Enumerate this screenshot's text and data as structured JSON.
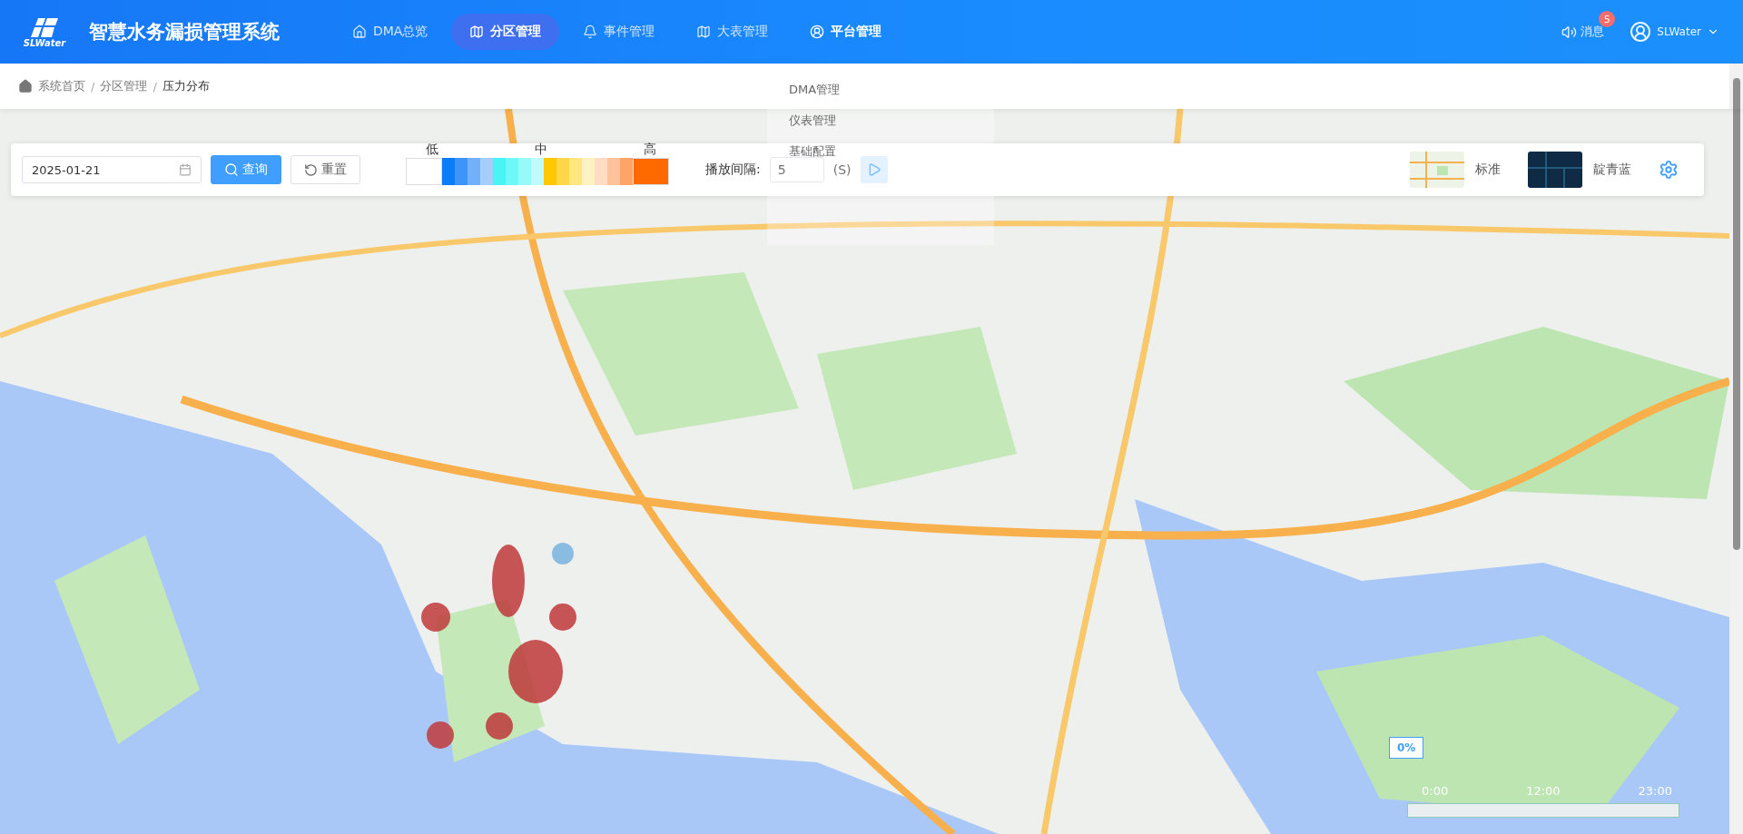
{
  "header": {
    "logo_text": "SLWater",
    "title": "智慧水务漏损管理系统",
    "nav": [
      {
        "label": "DMA总览",
        "selected": false,
        "expanded": false
      },
      {
        "label": "分区管理",
        "selected": true,
        "expanded": false
      },
      {
        "label": "事件管理",
        "selected": false,
        "expanded": false
      },
      {
        "label": "大表管理",
        "selected": false,
        "expanded": false
      },
      {
        "label": "平台管理",
        "selected": false,
        "expanded": true
      }
    ],
    "messages": {
      "label": "消息",
      "badge": "5"
    },
    "user": "SLWater"
  },
  "breadcrumb": {
    "separator": "/",
    "items": [
      "系统首页",
      "分区管理",
      "压力分布"
    ]
  },
  "dropdown": [
    "DMA管理",
    "仪表管理",
    "基础配置"
  ],
  "toolbar": {
    "date": "2025-01-21",
    "query": "查询",
    "reset": "重置",
    "legend": {
      "low": "低",
      "mid": "中",
      "high": "高",
      "cells": [
        {
          "color": "#ffffff"
        },
        {
          "color": "#0a7cf7"
        },
        {
          "color": "#3d95f8"
        },
        {
          "color": "#72b1f9"
        },
        {
          "color": "#a6cdfb"
        },
        {
          "color": "#48f5f5"
        },
        {
          "color": "#6ff8f8"
        },
        {
          "color": "#97f9f9"
        },
        {
          "color": "#bffbfb"
        },
        {
          "color": "#ffc800"
        },
        {
          "color": "#ffd84a"
        },
        {
          "color": "#ffe680"
        },
        {
          "color": "#fff2c2"
        },
        {
          "color": "#ffdcc2"
        },
        {
          "color": "#ffc29a"
        },
        {
          "color": "#ffa467"
        },
        {
          "color": "#ff6a00"
        }
      ]
    },
    "interval_label": "播放间隔:",
    "interval_value": "5",
    "interval_unit": "(S)",
    "layers": [
      {
        "label": "标准",
        "kind": "light"
      },
      {
        "label": "靛青蓝",
        "kind": "dark"
      }
    ]
  },
  "timeline": {
    "tooltip": "0%",
    "ticks": [
      "0:00",
      "12:00",
      "23:00"
    ],
    "level": 0
  }
}
